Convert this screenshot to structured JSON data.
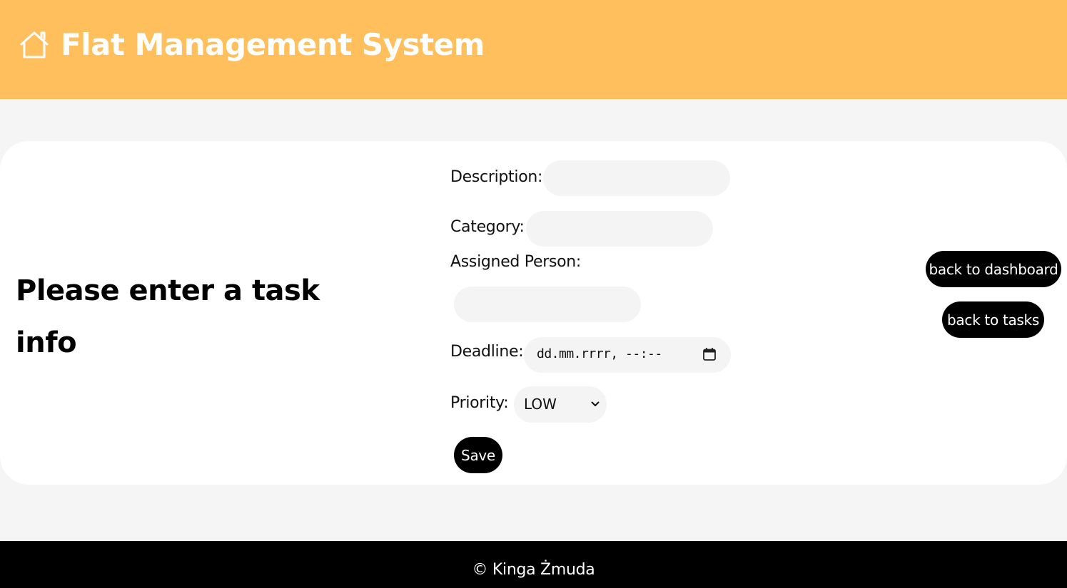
{
  "header": {
    "title": "Flat Management System",
    "icon": "home-icon",
    "background_color": "#ffbf5c"
  },
  "main": {
    "heading": "Please enter a task info"
  },
  "form": {
    "description_label": "Description:",
    "description_value": "",
    "category_label": "Category:",
    "category_value": "",
    "assigned_person_label": "Assigned Person:",
    "assigned_person_value": "",
    "deadline_label": "Deadline:",
    "deadline_placeholder": "dd.mm.rrrr, --:--",
    "priority_label": "Priority:",
    "priority_selected": "LOW",
    "save_label": "Save"
  },
  "nav": {
    "back_to_dashboard": "back to dashboard",
    "back_to_tasks": "back to tasks"
  },
  "footer": {
    "copyright": "© Kinga Żmuda"
  }
}
